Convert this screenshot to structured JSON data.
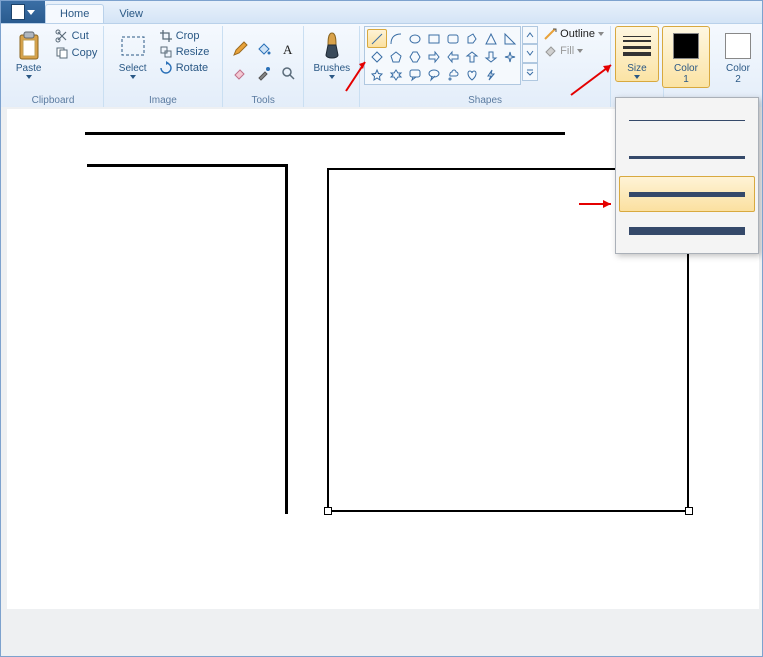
{
  "tabs": {
    "home": "Home",
    "view": "View"
  },
  "clipboard": {
    "paste": "Paste",
    "cut": "Cut",
    "copy": "Copy",
    "label": "Clipboard"
  },
  "image": {
    "select": "Select",
    "crop": "Crop",
    "resize": "Resize",
    "rotate": "Rotate",
    "label": "Image"
  },
  "tools": {
    "label": "Tools"
  },
  "brushes": {
    "label": "Brushes"
  },
  "shapes": {
    "label": "Shapes",
    "outline": "Outline",
    "fill": "Fill"
  },
  "size": {
    "label": "Size"
  },
  "colors": {
    "color1": "Color\n1",
    "color2": "Color\n2",
    "c1": "#000000",
    "c2": "#ffffff"
  },
  "size_menu": {
    "options": [
      {
        "px": 1
      },
      {
        "px": 3
      },
      {
        "px": 5
      },
      {
        "px": 8
      }
    ],
    "selected_index": 2
  }
}
